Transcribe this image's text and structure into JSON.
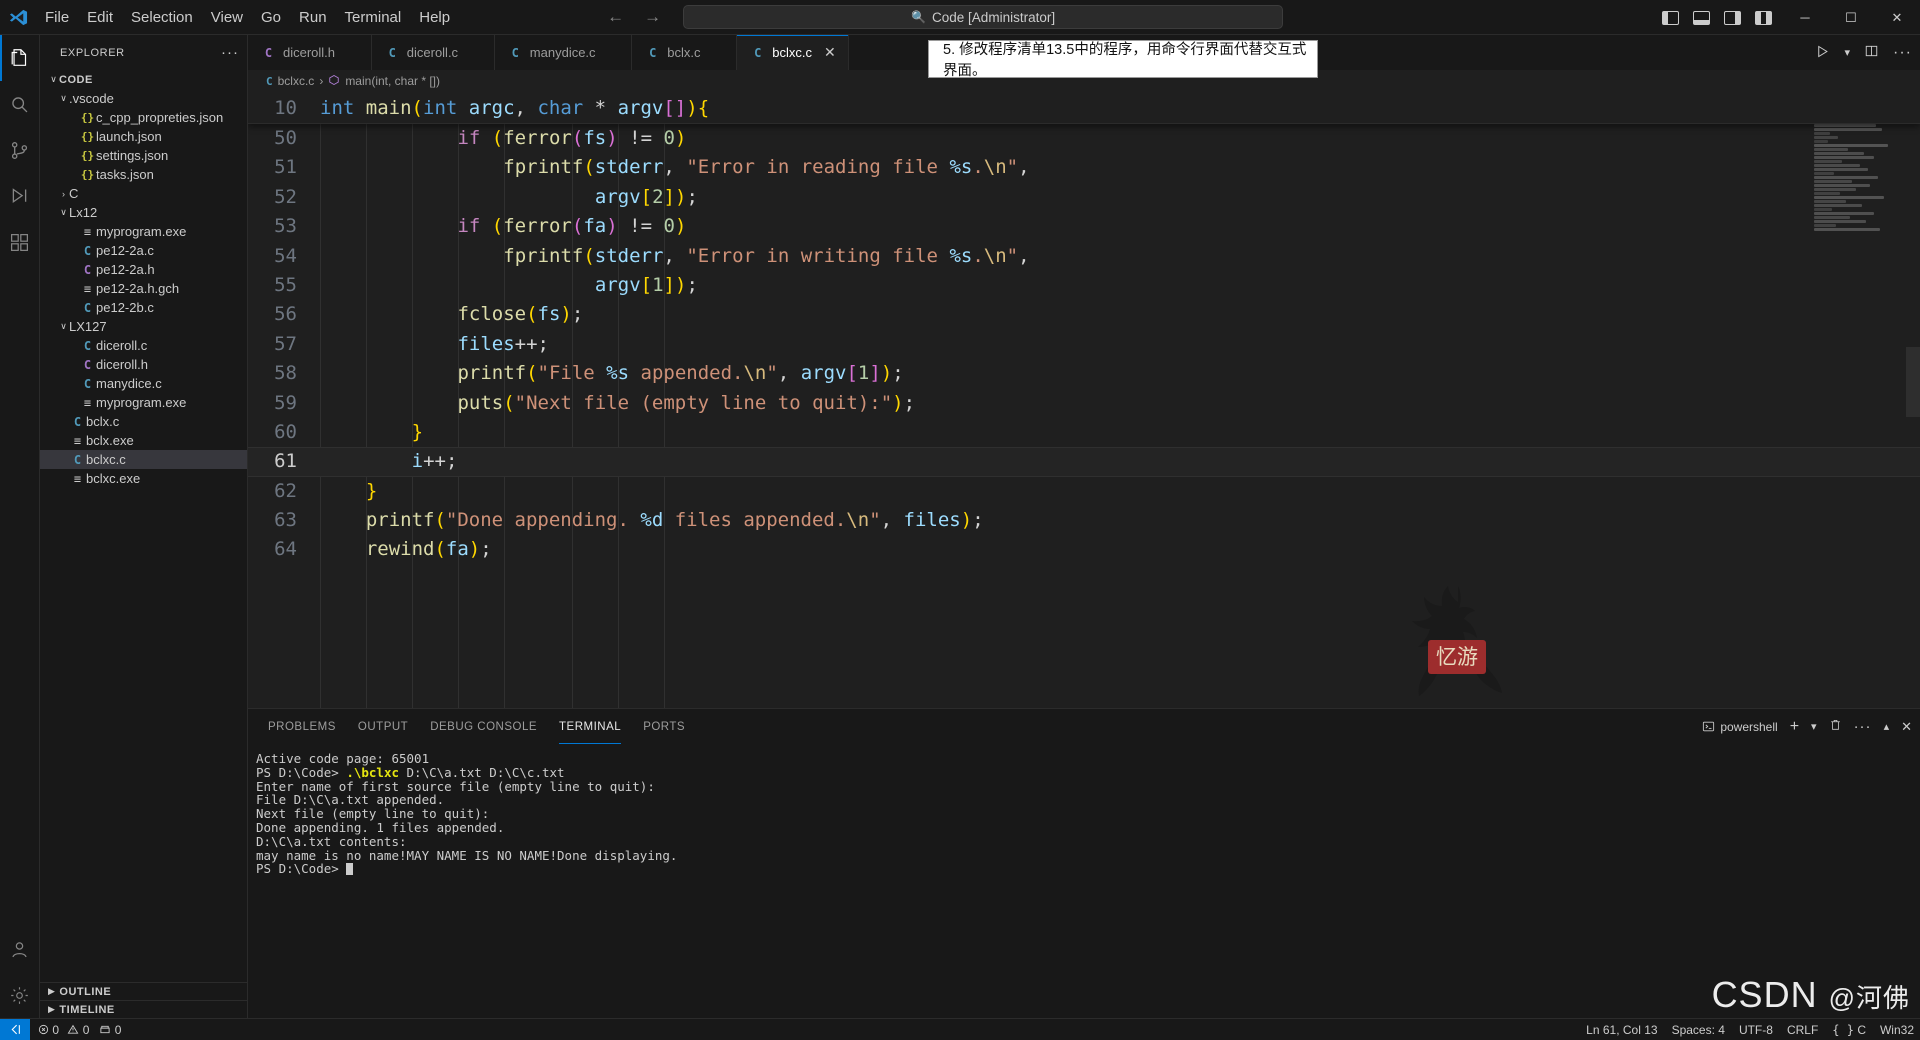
{
  "titlebar": {
    "menus": [
      "File",
      "Edit",
      "Selection",
      "View",
      "Go",
      "Run",
      "Terminal",
      "Help"
    ],
    "back_icon": "arrow-left-icon",
    "forward_icon": "arrow-right-icon",
    "quick_input": "Code [Administrator]",
    "quick_input_icon": "search-icon",
    "window_minimize": "─",
    "window_maximize": "☐",
    "window_close": "✕"
  },
  "activitybar": {
    "items": [
      {
        "name": "explorer",
        "icon": "files-icon",
        "active": true
      },
      {
        "name": "search",
        "icon": "search-icon",
        "active": false
      },
      {
        "name": "source-control",
        "icon": "source-control-icon",
        "active": false
      },
      {
        "name": "run-and-debug",
        "icon": "run-debug-icon",
        "active": false
      },
      {
        "name": "extensions",
        "icon": "extensions-icon",
        "active": false
      }
    ],
    "bottom": [
      {
        "name": "accounts",
        "icon": "account-icon"
      },
      {
        "name": "manage",
        "icon": "gear-icon"
      }
    ]
  },
  "sidebar": {
    "title": "EXPLORER",
    "more_actions": "···",
    "tree": [
      {
        "label": "CODE",
        "indent": 0,
        "twisty": "chevron-down",
        "icon": "",
        "kind": "root"
      },
      {
        "label": ".vscode",
        "indent": 1,
        "twisty": "chevron-down",
        "icon": "",
        "kind": "folder"
      },
      {
        "label": "c_cpp_propreties.json",
        "indent": 2,
        "twisty": "",
        "icon": "json",
        "kind": "file"
      },
      {
        "label": "launch.json",
        "indent": 2,
        "twisty": "",
        "icon": "json",
        "kind": "file"
      },
      {
        "label": "settings.json",
        "indent": 2,
        "twisty": "",
        "icon": "json",
        "kind": "file"
      },
      {
        "label": "tasks.json",
        "indent": 2,
        "twisty": "",
        "icon": "json",
        "kind": "file"
      },
      {
        "label": "C",
        "indent": 1,
        "twisty": "chevron-right",
        "icon": "",
        "kind": "folder"
      },
      {
        "label": "Lx12",
        "indent": 1,
        "twisty": "chevron-down",
        "icon": "",
        "kind": "folder"
      },
      {
        "label": "myprogram.exe",
        "indent": 2,
        "twisty": "",
        "icon": "exe",
        "kind": "file"
      },
      {
        "label": "pe12-2a.c",
        "indent": 2,
        "twisty": "",
        "icon": "c",
        "kind": "file"
      },
      {
        "label": "pe12-2a.h",
        "indent": 2,
        "twisty": "",
        "icon": "h",
        "kind": "file"
      },
      {
        "label": "pe12-2a.h.gch",
        "indent": 2,
        "twisty": "",
        "icon": "exe",
        "kind": "file"
      },
      {
        "label": "pe12-2b.c",
        "indent": 2,
        "twisty": "",
        "icon": "c",
        "kind": "file"
      },
      {
        "label": "LX127",
        "indent": 1,
        "twisty": "chevron-down",
        "icon": "",
        "kind": "folder"
      },
      {
        "label": "diceroll.c",
        "indent": 2,
        "twisty": "",
        "icon": "c",
        "kind": "file"
      },
      {
        "label": "diceroll.h",
        "indent": 2,
        "twisty": "",
        "icon": "h",
        "kind": "file"
      },
      {
        "label": "manydice.c",
        "indent": 2,
        "twisty": "",
        "icon": "c",
        "kind": "file"
      },
      {
        "label": "myprogram.exe",
        "indent": 2,
        "twisty": "",
        "icon": "exe",
        "kind": "file"
      },
      {
        "label": "bclx.c",
        "indent": 1,
        "twisty": "",
        "icon": "c",
        "kind": "file"
      },
      {
        "label": "bclx.exe",
        "indent": 1,
        "twisty": "",
        "icon": "exe",
        "kind": "file"
      },
      {
        "label": "bclxc.c",
        "indent": 1,
        "twisty": "",
        "icon": "c",
        "kind": "file",
        "selected": true
      },
      {
        "label": "bclxc.exe",
        "indent": 1,
        "twisty": "",
        "icon": "exe",
        "kind": "file"
      }
    ],
    "sections": [
      {
        "label": "OUTLINE",
        "twisty": "chevron-right"
      },
      {
        "label": "TIMELINE",
        "twisty": "chevron-right"
      }
    ]
  },
  "editor": {
    "tabs": [
      {
        "label": "diceroll.h",
        "icon": "h",
        "active": false
      },
      {
        "label": "diceroll.c",
        "icon": "c",
        "active": false
      },
      {
        "label": "manydice.c",
        "icon": "c",
        "active": false
      },
      {
        "label": "bclx.c",
        "icon": "c",
        "active": false
      },
      {
        "label": "bclxc.c",
        "icon": "c",
        "active": true
      }
    ],
    "tab_close_icon": "✕",
    "actions": [
      "run-icon",
      "chevron-down-icon",
      "split-editor-icon",
      "more-actions-icon"
    ],
    "actions_labels": {
      "run": "▷",
      "chevron": "ˇ",
      "split": "◫",
      "more": "···"
    },
    "breadcrumb": {
      "file_icon": "c",
      "file": "bclxc.c",
      "separator": "›",
      "symbol_icon": "symbol-method-icon",
      "symbol": "main(int, char * [])"
    },
    "sticky": {
      "line_no": "10",
      "text": "int main(int argc, char * argv[]){"
    },
    "lines": [
      {
        "no": "50",
        "text": "            if (ferror(fs) != 0)",
        "current": false
      },
      {
        "no": "51",
        "text": "                fprintf(stderr, \"Error in reading file %s.\\n\",",
        "current": false
      },
      {
        "no": "52",
        "text": "                        argv[2]);",
        "current": false
      },
      {
        "no": "53",
        "text": "            if (ferror(fa) != 0)",
        "current": false
      },
      {
        "no": "54",
        "text": "                fprintf(stderr, \"Error in writing file %s.\\n\",",
        "current": false
      },
      {
        "no": "55",
        "text": "                        argv[1]);",
        "current": false
      },
      {
        "no": "56",
        "text": "            fclose(fs);",
        "current": false
      },
      {
        "no": "57",
        "text": "            files++;",
        "current": false
      },
      {
        "no": "58",
        "text": "            printf(\"File %s appended.\\n\", argv[1]);",
        "current": false
      },
      {
        "no": "59",
        "text": "            puts(\"Next file (empty line to quit):\");",
        "current": false
      },
      {
        "no": "60",
        "text": "        }",
        "current": false
      },
      {
        "no": "61",
        "text": "        i++;",
        "current": true
      },
      {
        "no": "62",
        "text": "    }",
        "current": false
      },
      {
        "no": "63",
        "text": "    printf(\"Done appending. %d files appended.\\n\", files);",
        "current": false
      },
      {
        "no": "64",
        "text": "    rewind(fa);",
        "current": false
      }
    ]
  },
  "panel": {
    "tabs": [
      {
        "label": "PROBLEMS",
        "active": false
      },
      {
        "label": "OUTPUT",
        "active": false
      },
      {
        "label": "DEBUG CONSOLE",
        "active": false
      },
      {
        "label": "TERMINAL",
        "active": true
      },
      {
        "label": "PORTS",
        "active": false
      }
    ],
    "shell_label": "powershell",
    "shell_icon": "terminal-powershell-icon",
    "actions": {
      "new_terminal": "+",
      "split_chevron": "ˇ",
      "kill": "trash-icon",
      "more": "···",
      "maximize": "chevron-up-icon",
      "close": "✕"
    },
    "terminal_lines": [
      {
        "text": "Active code page: 65001",
        "kind": "plain"
      },
      {
        "text": "PS D:\\Code> .\\bclxc D:\\C\\a.txt D:\\C\\c.txt",
        "kind": "command"
      },
      {
        "text": "Enter name of first source file (empty line to quit):",
        "kind": "plain"
      },
      {
        "text": "File D:\\C\\a.txt appended.",
        "kind": "plain"
      },
      {
        "text": "Next file (empty line to quit):",
        "kind": "plain"
      },
      {
        "text": "Done appending. 1 files appended.",
        "kind": "plain"
      },
      {
        "text": "D:\\C\\a.txt contents:",
        "kind": "plain"
      },
      {
        "text": "may name is no name!MAY NAME IS NO NAME!Done displaying.",
        "kind": "plain"
      },
      {
        "text": "PS D:\\Code> ",
        "kind": "prompt"
      }
    ]
  },
  "statusbar": {
    "remote_icon": "remote-indicator-icon",
    "errors_icon": "error-icon",
    "errors": "0",
    "warnings_icon": "warning-icon",
    "warnings": "0",
    "ports_icon": "ports-icon",
    "ports": "0",
    "position": "Ln 61, Col 13",
    "spaces": "Spaces: 4",
    "encoding": "UTF-8",
    "eol": "CRLF",
    "language": "C",
    "language_icon": "braces-icon",
    "platform": "Win32"
  },
  "overlays": {
    "annotation": "5. 修改程序清单13.5中的程序，用命令行界面代替交互式界面。",
    "watermark_main": "CSDN",
    "watermark_sub": "@河佛",
    "sticker_text": "忆游"
  },
  "colors": {
    "accent": "#0078d4",
    "bg": "#1f1f1f",
    "chrome": "#181818",
    "selected_row": "#37373d",
    "annotation_bg": "#ffffff"
  }
}
